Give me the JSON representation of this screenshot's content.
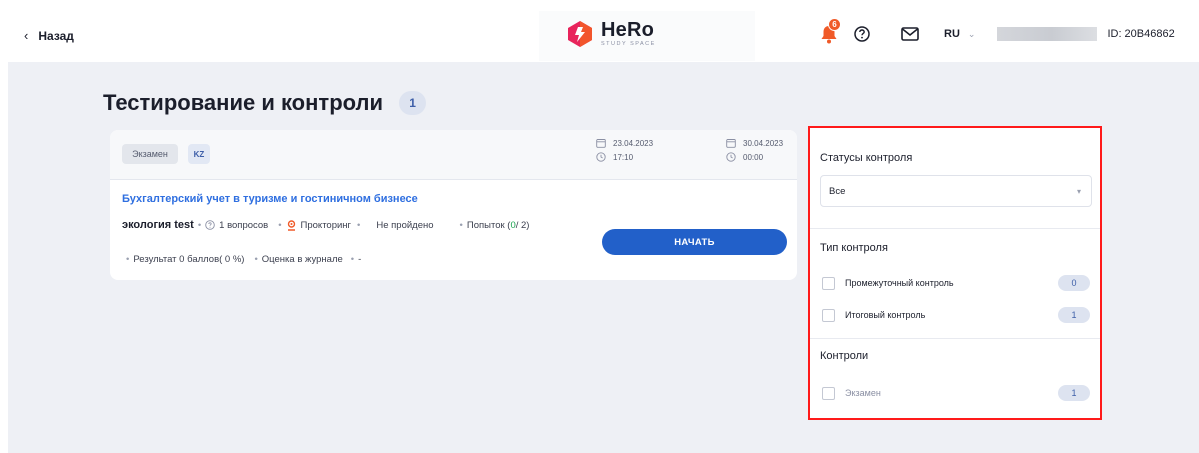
{
  "header": {
    "back_label": "Назад",
    "logo_title": "HeRo",
    "logo_subtitle": "STUDY SPACE",
    "notifications_count": "6",
    "language": "RU",
    "user_id": "ID: 20B46862"
  },
  "page": {
    "title": "Тестирование и контроли",
    "count": "1"
  },
  "card": {
    "type_tag": "Экзамен",
    "lang_tag": "KZ",
    "start": {
      "date": "23.04.2023",
      "time": "17:10"
    },
    "end": {
      "date": "30.04.2023",
      "time": "00:00"
    },
    "course_title": "Бухгалтерский учет в туризме и гостиничном бизнесе",
    "test_name": "экология test",
    "questions": "1 вопросов",
    "proctoring": "Прокторинг",
    "status": "Не пройдено",
    "attempts_label": "Попыток (",
    "attempts_used": "0",
    "attempts_total": " / 2)",
    "result": "Результат 0 баллов( 0 %)",
    "journal": "Оценка в журнале",
    "journal_value": "-",
    "start_button": "НАЧАТЬ"
  },
  "filters": {
    "status_title": "Статусы контроля",
    "status_value": "Все",
    "type_title": "Тип контроля",
    "types": [
      {
        "label": "Промежуточный контроль",
        "count": "0"
      },
      {
        "label": "Итоговый контроль",
        "count": "1"
      }
    ],
    "controls_title": "Контроли",
    "controls": [
      {
        "label": "Экзамен",
        "count": "1"
      }
    ]
  },
  "colors": {
    "accent_blue": "#2260c9",
    "link_blue": "#2f6fe0",
    "badge_orange": "#f05a28",
    "highlight_red": "#ff1a1a",
    "success_green": "#1aa250"
  }
}
